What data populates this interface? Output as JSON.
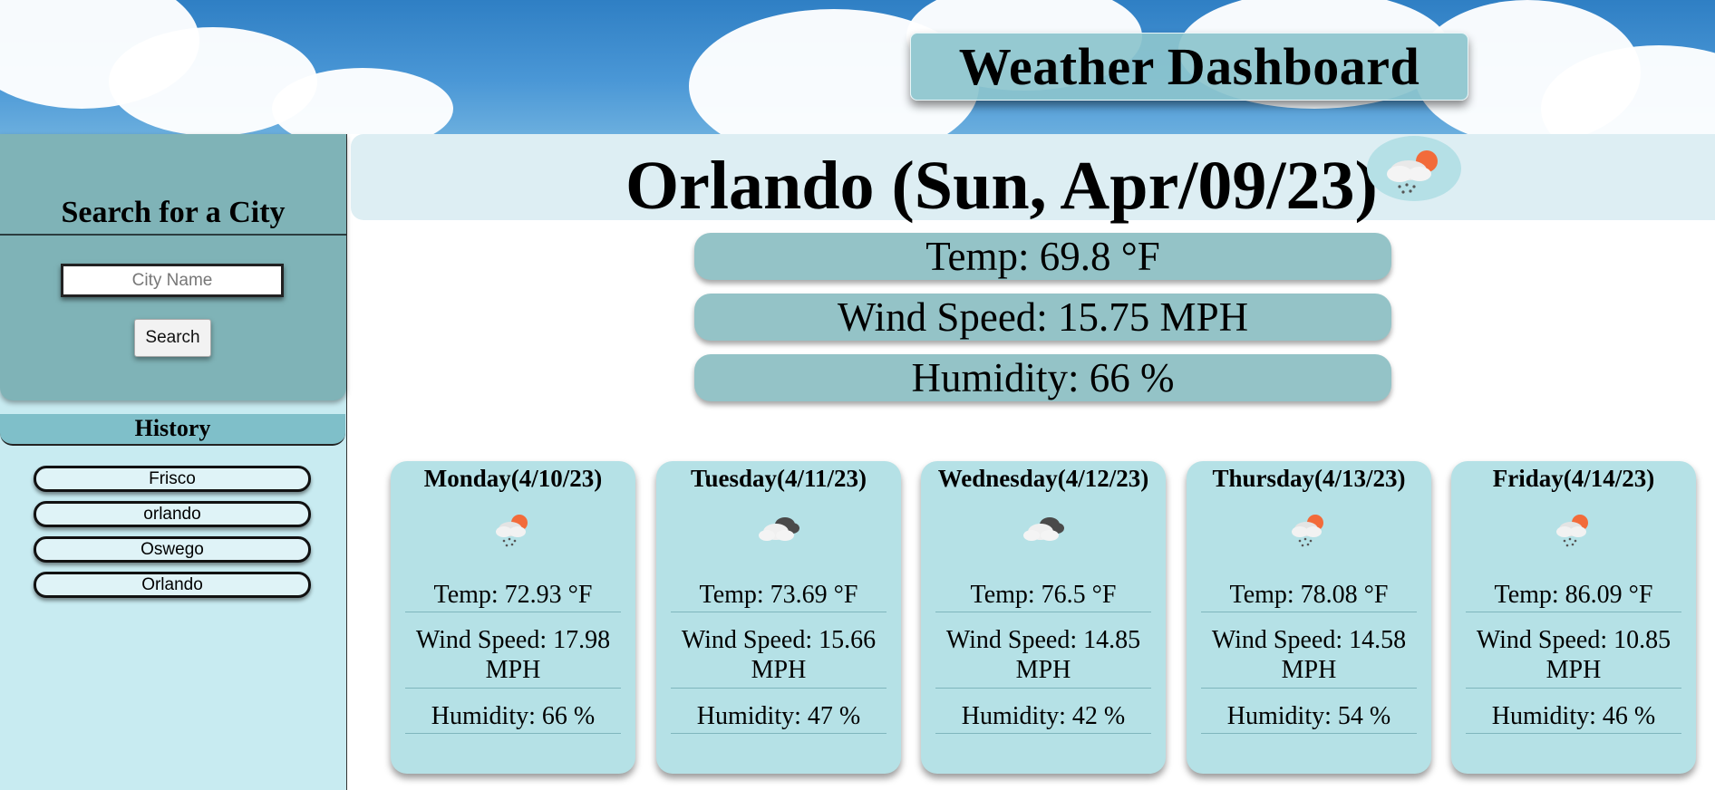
{
  "header": {
    "title": "Weather Dashboard"
  },
  "sidebar": {
    "search_title": "Search for a City",
    "city_placeholder": "City Name",
    "search_button": "Search",
    "history_title": "History",
    "history_items": [
      "Frisco",
      "orlando",
      "Oswego",
      "Orlando"
    ]
  },
  "current": {
    "title": "Orlando (Sun, Apr/09/23)",
    "icon": "rain-sun-icon",
    "temp": "Temp: 69.8 °F",
    "wind": "Wind Speed: 15.75 MPH",
    "humidity": "Humidity: 66 %"
  },
  "forecast": [
    {
      "day": "Monday(4/10/23)",
      "icon": "rain-sun-icon",
      "temp": "Temp: 72.93 °F",
      "wind": "Wind Speed: 17.98 MPH",
      "humidity": "Humidity: 66 %"
    },
    {
      "day": "Tuesday(4/11/23)",
      "icon": "cloudy-icon",
      "temp": "Temp: 73.69 °F",
      "wind": "Wind Speed: 15.66 MPH",
      "humidity": "Humidity: 47 %"
    },
    {
      "day": "Wednesday(4/12/23)",
      "icon": "cloudy-icon",
      "temp": "Temp: 76.5 °F",
      "wind": "Wind Speed: 14.85 MPH",
      "humidity": "Humidity: 42 %"
    },
    {
      "day": "Thursday(4/13/23)",
      "icon": "rain-sun-icon",
      "temp": "Temp: 78.08 °F",
      "wind": "Wind Speed: 14.58 MPH",
      "humidity": "Humidity: 54 %"
    },
    {
      "day": "Friday(4/14/23)",
      "icon": "rain-sun-icon",
      "temp": "Temp: 86.09 °F",
      "wind": "Wind Speed: 10.85 MPH",
      "humidity": "Humidity: 46 %"
    }
  ]
}
